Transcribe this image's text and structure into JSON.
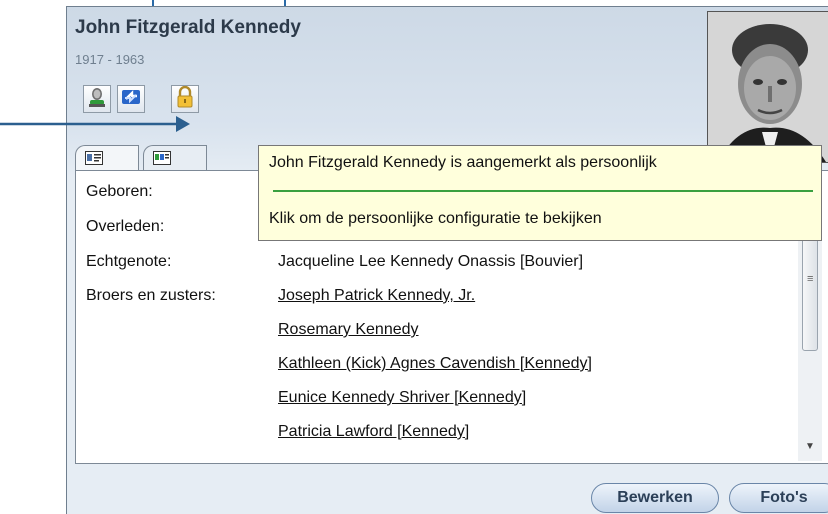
{
  "person": {
    "name": "John Fitzgerald Kennedy",
    "years": "1917 - 1963"
  },
  "toolbar": {
    "icons": [
      "person-icon",
      "sync-icon",
      "lock-icon"
    ]
  },
  "tabs": [
    {
      "icon": "id-card-icon"
    },
    {
      "icon": "family-card-icon"
    }
  ],
  "tooltip": {
    "line1": "John Fitzgerald Kennedy is aangemerkt als persoonlijk",
    "line2": "Klik om de persoonlijke configuratie te bekijken"
  },
  "details": {
    "born_label": "Geboren:",
    "died_label": "Overleden:",
    "spouse_label": "Echtgenote:",
    "spouse_value": "Jacqueline Lee Kennedy Onassis [Bouvier]",
    "siblings_label": "Broers en zusters:",
    "siblings": [
      "Joseph Patrick Kennedy, Jr.",
      "Rosemary Kennedy",
      "Kathleen (Kick) Agnes Cavendish [Kennedy]",
      "Eunice Kennedy Shriver [Kennedy]",
      "Patricia Lawford [Kennedy]"
    ]
  },
  "buttons": {
    "edit": "Bewerken",
    "photos": "Foto's"
  },
  "colors": {
    "header_bg": "#cdd9e6",
    "tooltip_bg": "#ffffdc",
    "tooltip_separator": "#3aa040",
    "button_text": "#2c4058",
    "annotation_arrow": "#2b5f8f"
  }
}
